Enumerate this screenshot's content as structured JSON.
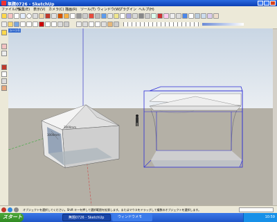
{
  "window": {
    "title": "無題0726 - SketchUp"
  },
  "menu": [
    "ファイル(F)",
    "編集(E)",
    "表示(V)",
    "カメラ(C)",
    "描画(R)",
    "ツール(T)",
    "ウィンドウ(W)",
    "プラグイン",
    "ヘルプ(H)"
  ],
  "layer": {
    "value": "レイヤ0"
  },
  "scene_tab": "シーン1",
  "viewport": {
    "dimension_labels": [
      "3000mm",
      "3000mm"
    ]
  },
  "status": {
    "text": "オブジェクトを選択してください。Shift キーを押して選択範囲を拡張します。またはマウスをドラッグして複数のオブジェクトを選択します。"
  },
  "taskbar": {
    "start": "スタート",
    "tasks": [
      "無題0726 - SketchUp",
      "ウィンドウメモ"
    ],
    "clock": "10:59"
  },
  "colors": {
    "sky_top": "#c9d6e4",
    "ground": "#b4b0a6",
    "selection": "#2b2bd6",
    "tent_roof": "#f2f2f2",
    "tent_side": "#cfcfcf"
  }
}
